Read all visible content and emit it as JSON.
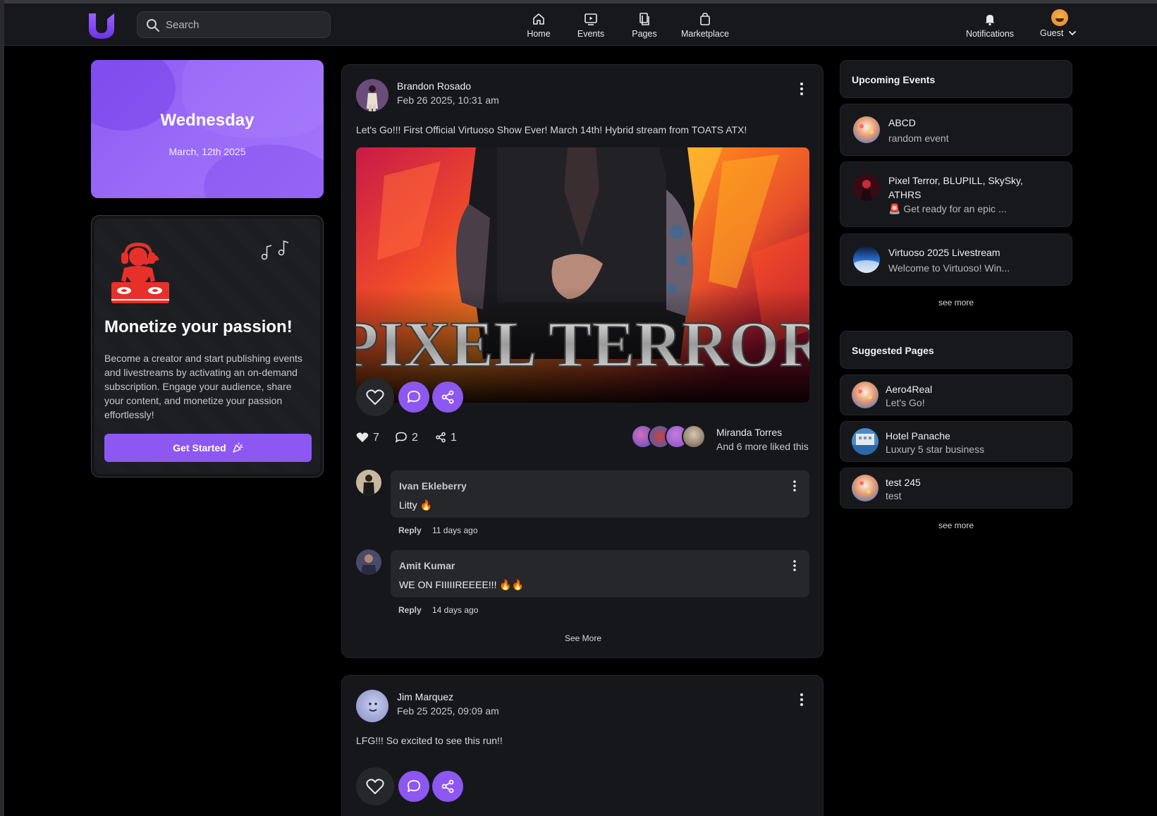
{
  "header": {
    "search_placeholder": "Search",
    "nav": [
      {
        "label": "Home",
        "icon": "home-icon"
      },
      {
        "label": "Events",
        "icon": "events-icon"
      },
      {
        "label": "Pages",
        "icon": "pages-icon"
      },
      {
        "label": "Marketplace",
        "icon": "marketplace-icon"
      }
    ],
    "notifications_label": "Notifications",
    "user_label": "Guest"
  },
  "date_card": {
    "day": "Wednesday",
    "date": "March, 12th 2025"
  },
  "promo": {
    "title": "Monetize your passion!",
    "body": "Become a creator and start publishing events and livestreams by activating an on-demand subscription. Engage your audience, share your content, and monetize your passion effortlessly!",
    "button": "Get Started"
  },
  "posts": [
    {
      "author": "Brandon Rosado",
      "time": "Feb 26 2025, 10:31 am",
      "text": "Let's Go!!! First Official Virtuoso Show Ever! March 14th! Hybrid stream from TOATS ATX!",
      "image_title": "PIXEL TERROR",
      "likes": "7",
      "comments_count": "2",
      "shares": "1",
      "liked_by_name": "Miranda Torres",
      "liked_by_more": "And 6 more liked this",
      "comments": [
        {
          "name": "Ivan Ekleberry",
          "text": "Litty 🔥",
          "reply": "Reply",
          "age": "11 days ago"
        },
        {
          "name": "Amit Kumar",
          "text": "WE ON FIIIIIREEEE!!! 🔥🔥",
          "reply": "Reply",
          "age": "14 days ago"
        }
      ],
      "see_more": "See More"
    },
    {
      "author": "Jim Marquez",
      "time": "Feb 25 2025, 09:09 am",
      "text": "LFG!!! So excited to see this run!!"
    }
  ],
  "upcoming_events": {
    "title": "Upcoming Events",
    "items": [
      {
        "title": "ABCD",
        "subtitle": "random event"
      },
      {
        "title": "Pixel Terror, BLUPILL, SkySky,",
        "title2": "ATHRS",
        "subtitle": "🚨 Get ready for an epic ..."
      },
      {
        "title": "Virtuoso 2025 Livestream",
        "subtitle": "Welcome to Virtuoso! Win..."
      }
    ],
    "see_more": "see more"
  },
  "suggested_pages": {
    "title": "Suggested Pages",
    "items": [
      {
        "title": "Aero4Real",
        "subtitle": "Let's Go!"
      },
      {
        "title": "Hotel Panache",
        "subtitle": "Luxury 5 star business"
      },
      {
        "title": "test 245",
        "subtitle": "test"
      }
    ],
    "see_more": "see more"
  },
  "colors": {
    "accent": "#8d57f2",
    "background": "#000000",
    "card": "#16171b",
    "dj_red": "#e8302a"
  }
}
